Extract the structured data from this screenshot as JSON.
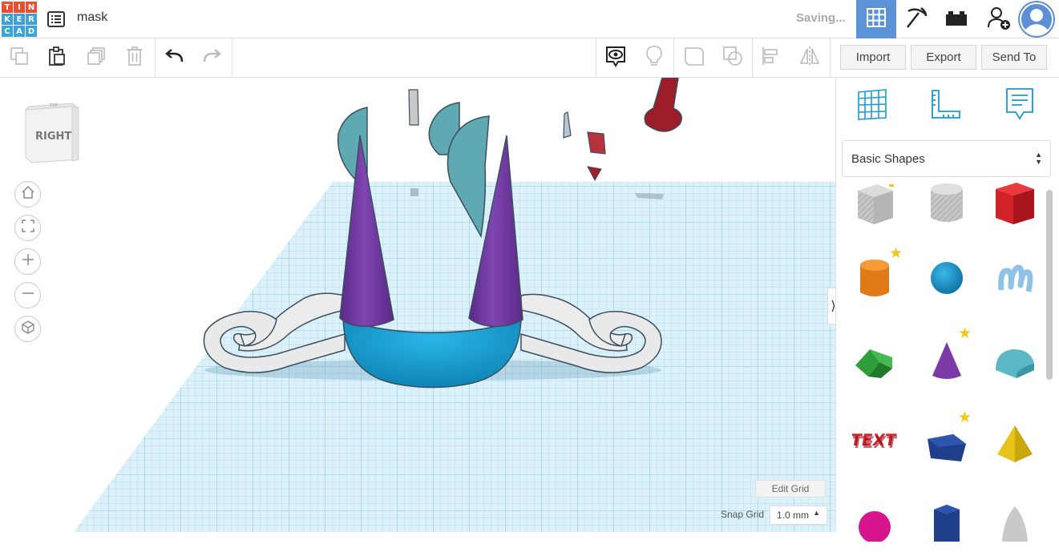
{
  "app": {
    "logo_letters": [
      "T",
      "I",
      "N",
      "K",
      "E",
      "R",
      "C",
      "A",
      "D"
    ],
    "logo_colors": [
      "#e94e2f",
      "#e94e2f",
      "#e94e2f",
      "#39a4d7",
      "#39a4d7",
      "#39a4d7",
      "#39a4d7",
      "#39a4d7",
      "#39a4d7"
    ],
    "project_name": "mask",
    "status": "Saving...",
    "accent": "#5c92d6"
  },
  "top_nav": [
    {
      "name": "3d-design-icon",
      "active": true
    },
    {
      "name": "pickaxe-icon",
      "active": false
    },
    {
      "name": "bricks-icon",
      "active": false
    },
    {
      "name": "add-user-icon",
      "active": false
    }
  ],
  "toolbar": {
    "import_label": "Import",
    "export_label": "Export",
    "send_to_label": "Send To"
  },
  "viewcube": {
    "face_label": "RIGHT"
  },
  "workplane": {
    "edit_grid_label": "Edit Grid",
    "snap_grid_label": "Snap Grid",
    "snap_grid_value": "1.0 mm"
  },
  "panel": {
    "category": "Basic Shapes",
    "shapes": [
      {
        "name": "box-hole",
        "color": "#b9b9b9",
        "starred": false
      },
      {
        "name": "cylinder-hole",
        "color": "#b9b9b9",
        "starred": false
      },
      {
        "name": "box",
        "color": "#d8232a",
        "starred": false
      },
      {
        "name": "cylinder",
        "color": "#e57e1b",
        "starred": true
      },
      {
        "name": "sphere",
        "color": "#1f9bd1",
        "starred": false
      },
      {
        "name": "scribble",
        "color": "#8fc2e6",
        "starred": false
      },
      {
        "name": "roof",
        "color": "#2e9e3a",
        "starred": false
      },
      {
        "name": "cone",
        "color": "#7b3aa6",
        "starred": true
      },
      {
        "name": "round-roof",
        "color": "#5ab8c4",
        "starred": false
      },
      {
        "name": "text",
        "color": "#d8232a",
        "starred": false
      },
      {
        "name": "polygon",
        "color": "#1f3f8a",
        "starred": true
      },
      {
        "name": "pyramid",
        "color": "#e6c41c",
        "starred": false
      },
      {
        "name": "torus-partial",
        "color": "#d6158c",
        "starred": false
      },
      {
        "name": "hexagonal-prism",
        "color": "#1f3f8a",
        "starred": false
      },
      {
        "name": "paraboloid",
        "color": "#c9c9c9",
        "starred": false
      }
    ]
  }
}
